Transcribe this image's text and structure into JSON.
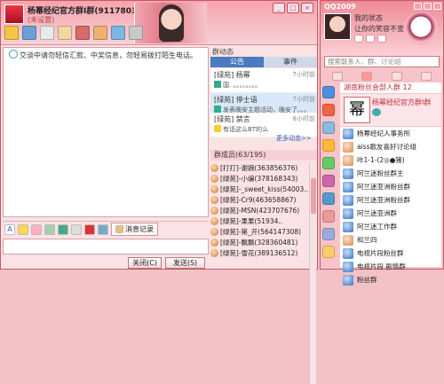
{
  "chat_window": {
    "group_title": "杨幂经纪官方群I群(91178037)",
    "group_subtitle": "(未设置)",
    "toolbar": [
      "folder-icon",
      "computer-icon",
      "album-icon",
      "card-icon",
      "mail-icon",
      "people-icon",
      "settings-icon",
      "more-icon"
    ],
    "notice": "交谈中请勿轻信汇款、中奖信息，勿轻易拨打陌生电话。",
    "format_bar": {
      "record_label": "消息记录"
    },
    "buttons": {
      "close": "关闭(C)",
      "send": "发送(S)"
    }
  },
  "side_panel": {
    "title": "群动态",
    "tabs": [
      "公告",
      "事件"
    ],
    "announcements": [
      {
        "title": "[绿苑] 杨幂",
        "time": "7小时前",
        "body": "国. 。。。。。。。。"
      },
      {
        "title": "[绿苑] 停士语",
        "time": "7小时前",
        "body": "发表晚安主题活动，晚安了。。。"
      },
      {
        "title": "[绿苑] 禁言",
        "time": "8小时前",
        "body": "有话这么BT的么"
      }
    ],
    "more_link": "更多动态>>",
    "members_header": "群成员(63/195)",
    "members": [
      "[打打]-谢婉(363856376)",
      "[绿苑]-小编(378168343)",
      "[绿苑]-_sweet_kiss(54003..",
      "[绿苑]-Cr9(463658867)",
      "[绿苑]-MSN(423707676)",
      "[绿苑]-果果(51934..",
      "[绿苑]-第_开(564147308)",
      "[绿苑]-飘飘(328360481)",
      "[绿苑]-雪花(389136512)"
    ]
  },
  "qq_panel": {
    "title": "QQ2009",
    "status": "我的状态",
    "signature": "让你的笑容不变",
    "search_placeholder": "搜索联系人、群、讨论组",
    "group_header": "湖南粉丝会部人群 12",
    "selected_contact": {
      "avatar_char": "幂",
      "name": "杨幂经纪官方群I群"
    },
    "contacts": [
      {
        "name": "杨幂经纪人事务所",
        "type": "group"
      },
      {
        "name": "aiss歌友喜好讨论组",
        "type": "person"
      },
      {
        "name": "咔1-1-(2◎●猪)",
        "type": "person"
      },
      {
        "name": "阿兰迷粉丝群主",
        "type": "group"
      },
      {
        "name": "阿兰迷亚洲粉丝群",
        "type": "group"
      },
      {
        "name": "阿兰迷亚洲粉丝群",
        "type": "group"
      },
      {
        "name": "阿兰迷亚洲群",
        "type": "group"
      },
      {
        "name": "阿兰迷工作群",
        "type": "group"
      },
      {
        "name": "和兰四",
        "type": "person"
      },
      {
        "name": "电视片段粉丝群",
        "type": "group"
      },
      {
        "name": "电视片段 剧情群",
        "type": "group"
      },
      {
        "name": "粉丝群",
        "type": "group"
      }
    ]
  },
  "colors": {
    "accent": "#c0283a",
    "frame": "#f6c4c9",
    "selection": "#d8e8f8"
  }
}
